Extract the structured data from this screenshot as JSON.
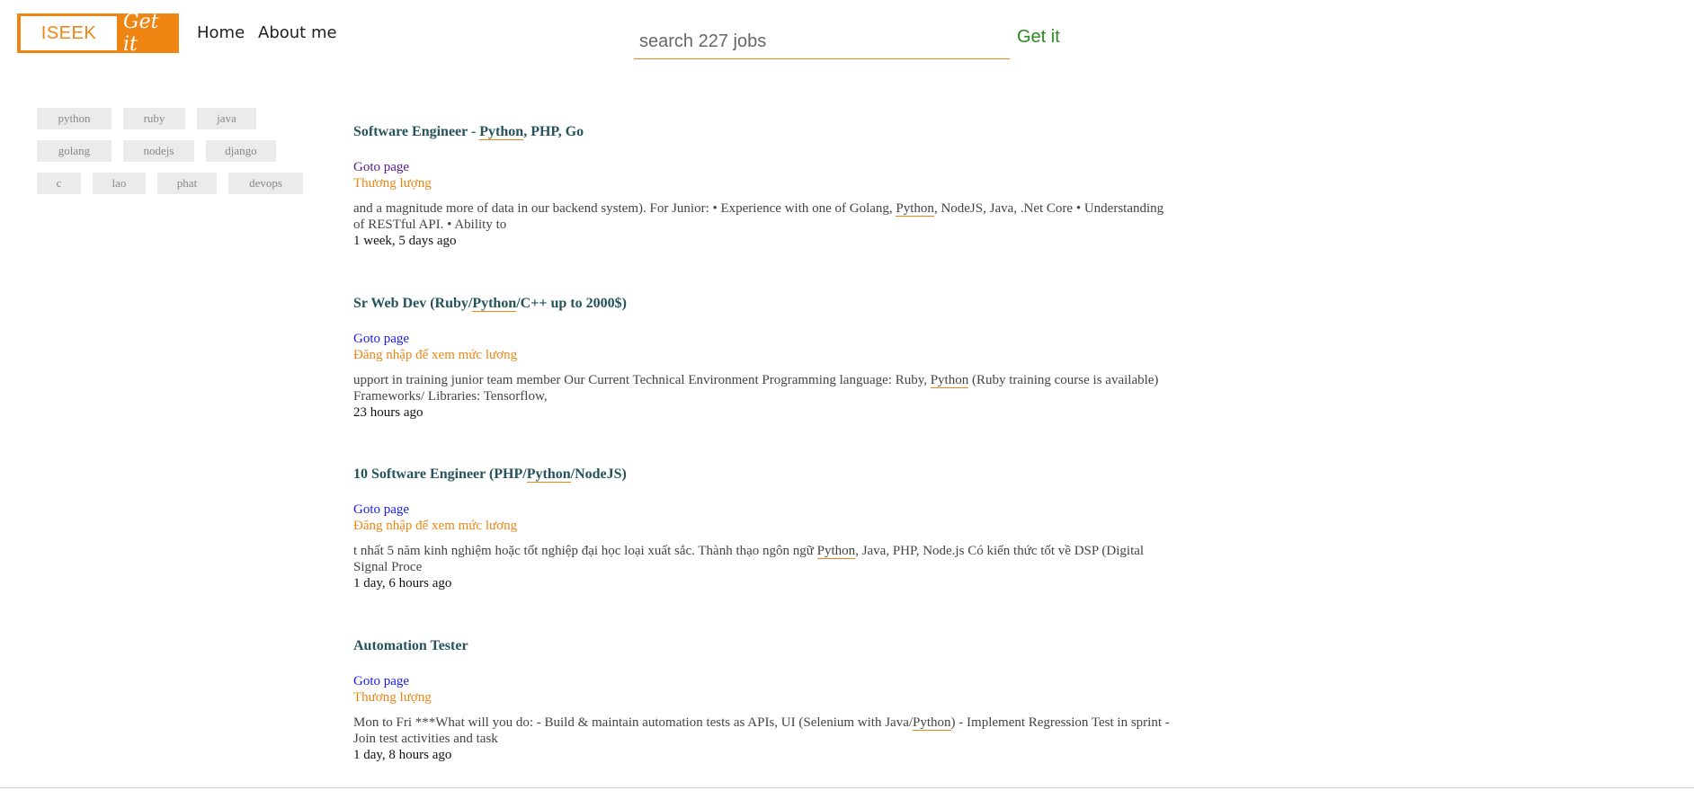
{
  "logo": {
    "brand": "ISEEK",
    "tagline": "Get it"
  },
  "nav": {
    "home": "Home",
    "about": "About me"
  },
  "search": {
    "placeholder": "search 227 jobs",
    "button": "Get it"
  },
  "tags": [
    [
      "python",
      "ruby",
      "java"
    ],
    [
      "golang",
      "nodejs",
      "django"
    ],
    [
      "c",
      "lao",
      "phat",
      "devops"
    ]
  ],
  "jobs": [
    {
      "title_parts": [
        "Software Engineer - ",
        "Python",
        ", PHP, Go"
      ],
      "link": "Goto page",
      "salary": "Thương lượng",
      "desc_parts": [
        "and a magnitude more of data in our backend system). For Junior: • Experience with one of Golang, ",
        "Python",
        ", NodeJS, Java, .Net Core • Understanding of RESTful API. • Ability to"
      ],
      "posted": "1 week, 5 days ago"
    },
    {
      "title_parts": [
        "Sr Web Dev (Ruby/",
        "Python",
        "/C++ up to 2000$)"
      ],
      "link": "Goto page",
      "salary": "Đăng nhập để xem mức lương",
      "desc_parts": [
        "upport in training junior team member Our Current Technical Environment Programming language: Ruby, ",
        "Python",
        " (Ruby training course is available) Frameworks/ Libraries: Tensorflow,"
      ],
      "posted": "23 hours ago"
    },
    {
      "title_parts": [
        "10 Software Engineer (PHP/",
        "Python",
        "/NodeJS)"
      ],
      "link": "Goto page",
      "salary": "Đăng nhập để xem mức lương",
      "desc_parts": [
        "t nhất 5 năm kinh nghiệm hoặc tốt nghiệp đại học loại xuất sắc. Thành thạo ngôn ngữ ",
        "Python",
        ", Java, PHP, Node.js Có kiến thức tốt về DSP (Digital Signal Proce"
      ],
      "posted": "1 day, 6 hours ago"
    },
    {
      "title_parts": [
        "Automation Tester",
        "",
        ""
      ],
      "link": "Goto page",
      "salary": "Thương lượng",
      "desc_parts": [
        "Mon to Fri ***What will you do: - Build & maintain automation tests as APIs, UI (Selenium with Java/",
        "Python",
        ") - Implement Regression Test in sprint - Join test activities and task"
      ],
      "posted": "1 day, 8 hours ago"
    }
  ]
}
